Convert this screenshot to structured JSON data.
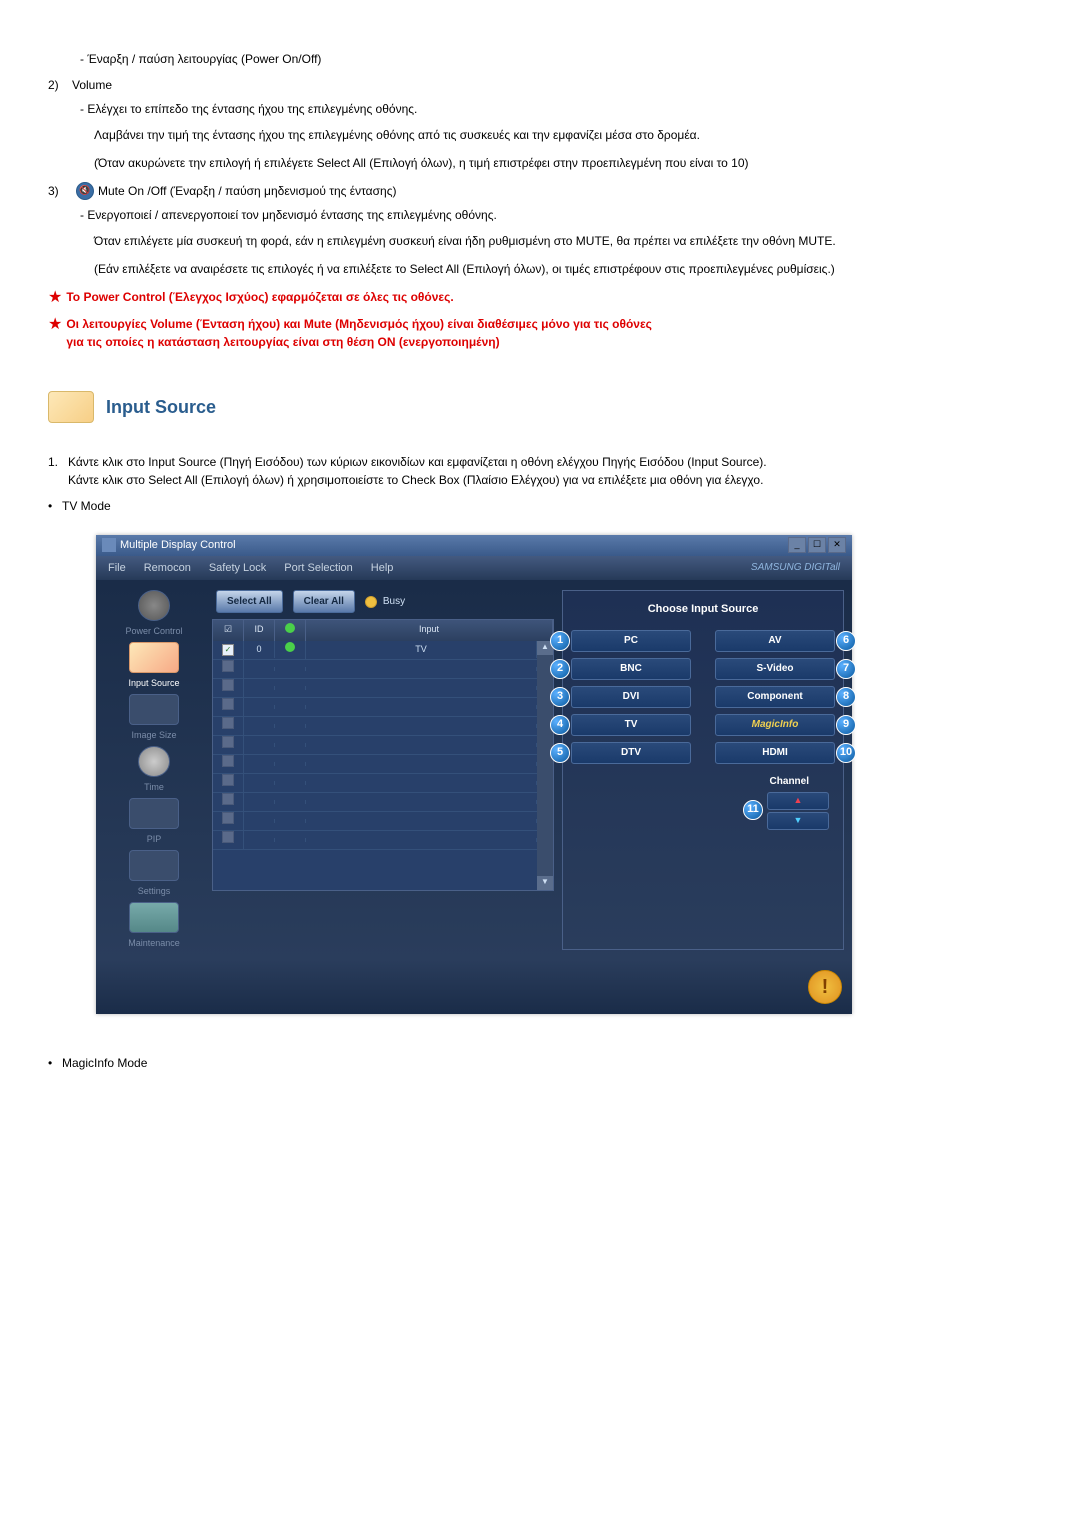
{
  "items": {
    "item1_text": "- Έναρξη / παύση λειτουργίας (Power On/Off)",
    "item2_idx": "2)",
    "item2_title": "Volume",
    "item2_line1": "- Ελέγχει το επίπεδο της έντασης ήχου της επιλεγμένης οθόνης.",
    "item2_line2": "Λαμβάνει την τιμή της έντασης ήχου της επιλεγμένης οθόνης από τις συσκευές και την εμφανίζει μέσα στο δρομέα.",
    "item2_line3": "(Όταν ακυρώνετε την επιλογή ή επιλέγετε Select All (Επιλογή όλων), η τιμή επιστρέφει στην προεπιλεγμένη που είναι το 10)",
    "item3_idx": "3)",
    "item3_title": "Mute On /Off (Έναρξη / παύση μηδενισμού της έντασης)",
    "item3_line1": "- Ενεργοποιεί / απενεργοποιεί τον μηδενισμό έντασης της επιλεγμένης οθόνης.",
    "item3_line2": "Όταν επιλέγετε μία συσκευή τη φορά, εάν η επιλεγμένη συσκευή είναι ήδη ρυθμισμένη στο MUTE, θα πρέπει να επιλέξετε την οθόνη MUTE.",
    "item3_line3": "(Εάν επιλέξετε να αναιρέσετε τις επιλογές ή να επιλέξετε το Select All (Επιλογή όλων), οι τιμές επιστρέφουν στις προεπιλεγμένες ρυθμίσεις.)"
  },
  "stars": {
    "s1": "Το Power Control (Έλεγχος Ισχύος) εφαρμόζεται σε όλες τις οθόνες.",
    "s2a": "Οι λειτουργίες Volume (Ένταση ήχου) και Mute (Μηδενισμός ήχου) είναι διαθέσιμες μόνο για τις οθόνες",
    "s2b": "για τις οποίες η κατάσταση λειτουργίας είναι στη θέση ON (ενεργοποιημένη)"
  },
  "section": {
    "title": "Input Source",
    "intro_idx": "1.",
    "intro_l1": "Κάντε κλικ στο Input Source (Πηγή Εισόδου) των κύριων εικονιδίων και εμφανίζεται η οθόνη ελέγχου Πηγής Εισόδου (Input Source).",
    "intro_l2": "Κάντε κλικ στο Select All (Επιλογή όλων) ή χρησιμοποιείστε το Check Box (Πλαίσιο Ελέγχου) για να επιλέξετε μια οθόνη για έλεγχο.",
    "tv_mode": "TV Mode",
    "magic_mode": "MagicInfo Mode"
  },
  "app": {
    "title": "Multiple Display Control",
    "menus": {
      "file": "File",
      "remocon": "Remocon",
      "safety": "Safety Lock",
      "port": "Port Selection",
      "help": "Help"
    },
    "brand": "SAMSUNG DIGITall",
    "sidebar": {
      "power": "Power Control",
      "input": "Input Source",
      "image": "Image Size",
      "time": "Time",
      "pip": "PIP",
      "settings": "Settings",
      "maint": "Maintenance"
    },
    "toolbar": {
      "select_all": "Select All",
      "clear_all": "Clear All",
      "busy": "Busy"
    },
    "table": {
      "chk": "☑",
      "id": "ID",
      "stat_h": "●",
      "input_h": "Input",
      "row1_id": "0",
      "row1_input": "TV"
    },
    "panel": {
      "title": "Choose Input Source",
      "pc": "PC",
      "av": "AV",
      "bnc": "BNC",
      "svideo": "S-Video",
      "dvi": "DVI",
      "component": "Component",
      "tv": "TV",
      "magic": "MagicInfo",
      "dtv": "DTV",
      "hdmi": "HDMI",
      "channel": "Channel"
    },
    "badges": {
      "b1": "1",
      "b2": "2",
      "b3": "3",
      "b4": "4",
      "b5": "5",
      "b6": "6",
      "b7": "7",
      "b8": "8",
      "b9": "9",
      "b10": "10",
      "b11": "11"
    }
  }
}
